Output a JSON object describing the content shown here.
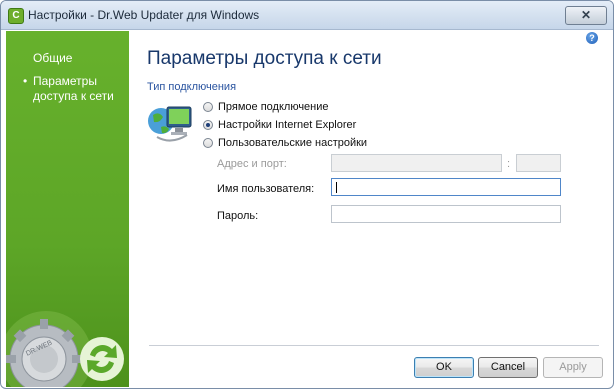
{
  "window": {
    "title": "Настройки - Dr.Web Updater для Windows",
    "app_icon_glyph": "C",
    "close_glyph": "✕"
  },
  "sidebar": {
    "items": [
      {
        "label": "Общие",
        "selected": false
      },
      {
        "label": "Параметры доступа к сети",
        "selected": true
      }
    ],
    "bullet": "•",
    "logo_text": "DR.WEB"
  },
  "help": {
    "glyph": "?"
  },
  "main": {
    "title": "Параметры доступа к сети",
    "section_label": "Тип подключения",
    "options": [
      {
        "label": "Прямое подключение",
        "checked": false
      },
      {
        "label": "Настройки Internet Explorer",
        "checked": true
      },
      {
        "label": "Пользовательские настройки",
        "checked": false
      }
    ],
    "fields": {
      "address_label": "Адрес и порт:",
      "address_value": "",
      "port_separator": ":",
      "port_value": "",
      "username_label": "Имя пользователя:",
      "username_value": "",
      "password_label": "Пароль:",
      "password_value": ""
    }
  },
  "buttons": {
    "ok": "OK",
    "cancel": "Cancel",
    "apply": "Apply"
  },
  "colors": {
    "sidebar_green": "#5da627",
    "title_blue": "#18386b",
    "section_blue": "#2a54a0"
  }
}
